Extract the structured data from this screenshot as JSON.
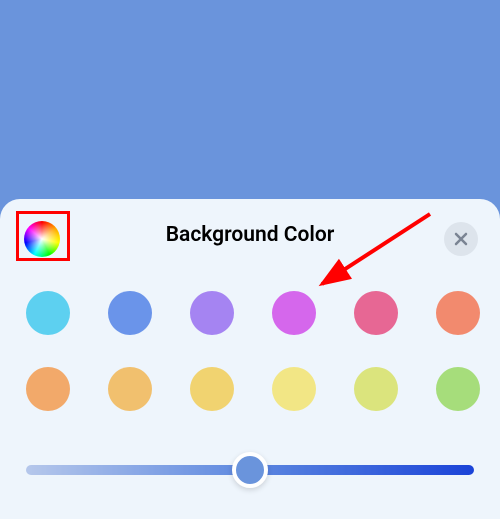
{
  "panel": {
    "title": "Background Color"
  },
  "swatches": {
    "row1": [
      {
        "name": "cyan",
        "hex": "#5dd0f0"
      },
      {
        "name": "blue",
        "hex": "#6a94ea"
      },
      {
        "name": "purple",
        "hex": "#a584f2"
      },
      {
        "name": "magenta",
        "hex": "#d567ec"
      },
      {
        "name": "pink",
        "hex": "#e76794"
      },
      {
        "name": "coral",
        "hex": "#f28a6e"
      }
    ],
    "row2": [
      {
        "name": "orange",
        "hex": "#f2a96a"
      },
      {
        "name": "amber",
        "hex": "#f1c06e"
      },
      {
        "name": "gold",
        "hex": "#f1d370"
      },
      {
        "name": "yellow",
        "hex": "#f2e685"
      },
      {
        "name": "lime",
        "hex": "#dbe47d"
      },
      {
        "name": "green",
        "hex": "#a6dd7b"
      }
    ]
  },
  "slider": {
    "position_percent": 50
  },
  "colors": {
    "background": "#6a94dc",
    "panel_bg": "#eef5fc",
    "annotation": "#ff0000"
  }
}
